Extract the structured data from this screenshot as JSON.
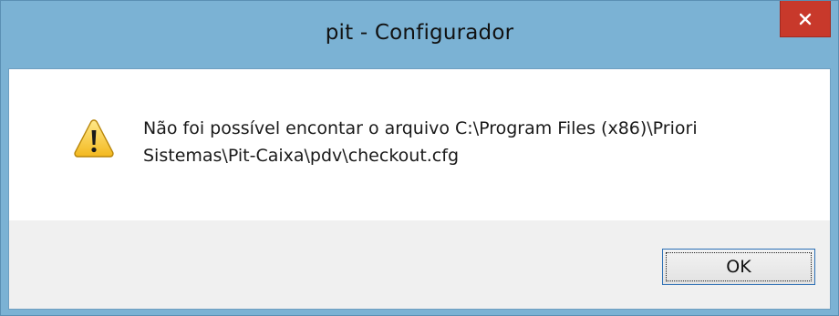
{
  "window": {
    "title": "pit - Configurador",
    "close_icon": "close-icon",
    "colors": {
      "titlebar": "#7bb2d4",
      "close_button": "#c8392b"
    }
  },
  "dialog": {
    "icon": "warning-icon",
    "message_line1": "Não foi possível encontar o arquivo C:\\Program Files (x86)\\Priori",
    "message_line2": "Sistemas\\Pit-Caixa\\pdv\\checkout.cfg",
    "ok_label": "OK"
  }
}
